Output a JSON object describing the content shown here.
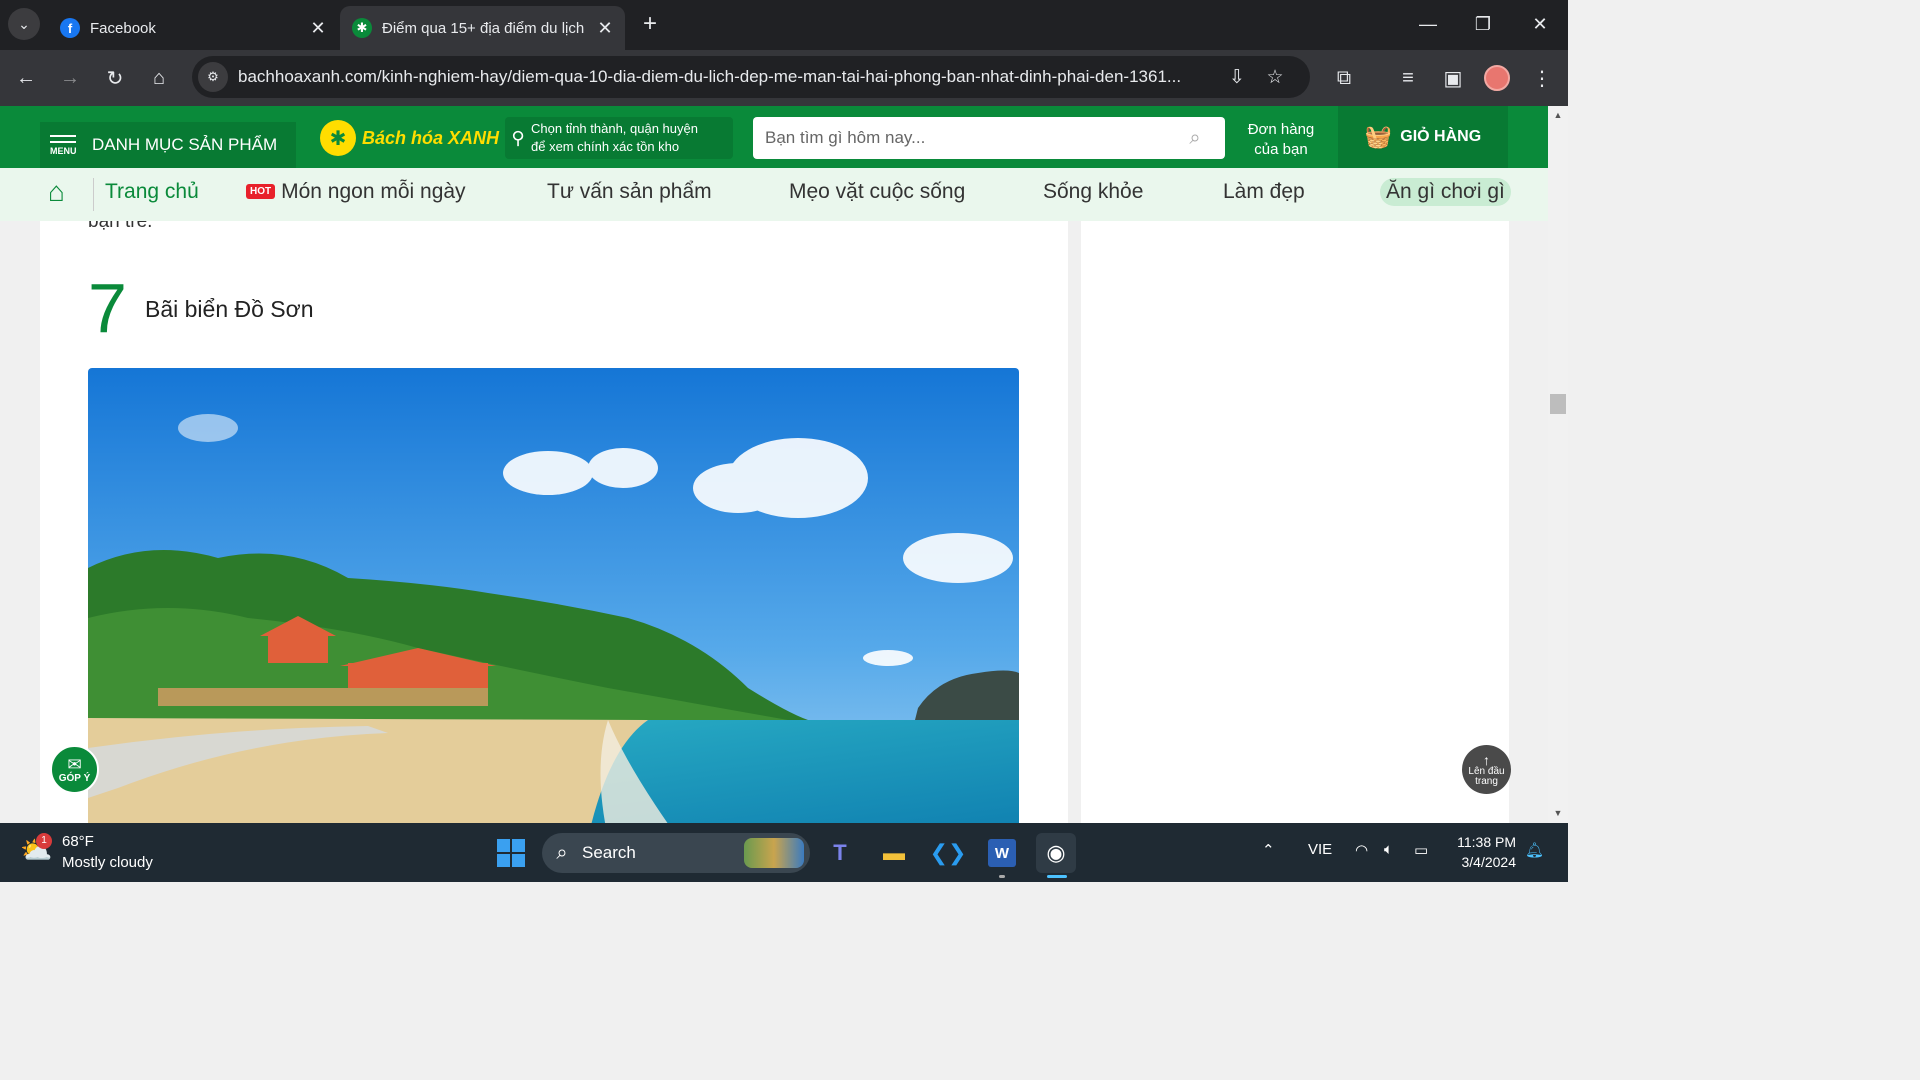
{
  "browser": {
    "tabs": [
      {
        "title": "Facebook",
        "favicon": "facebook-icon",
        "active": false
      },
      {
        "title": "Điểm qua 15+ địa điểm du lịch",
        "favicon": "bachhoaxanh-icon",
        "active": true
      }
    ],
    "url": "bachhoaxanh.com/kinh-nghiem-hay/diem-qua-10-dia-diem-du-lich-dep-me-man-tai-hai-phong-ban-nhat-dinh-phai-den-1361..."
  },
  "site": {
    "menu_label": "DANH MỤC SẢN PHẨM",
    "menu_small": "MENU",
    "logo_text": "Bách hóa XANH",
    "location_line1": "Chọn tỉnh thành, quận huyện",
    "location_line2": "để xem chính xác tồn kho",
    "search_placeholder": "Bạn tìm gì hôm nay...",
    "orders_line1": "Đơn hàng",
    "orders_line2": "của bạn",
    "cart_label": "GIỎ HÀNG",
    "brand_color": "#0a8a3a"
  },
  "nav": {
    "home": "Trang chủ",
    "hot_badge": "HOT",
    "items": [
      "Món ngon mỗi ngày",
      "Tư vấn sản phẩm",
      "Mẹo vặt cuộc sống",
      "Sống khỏe",
      "Làm đẹp",
      "Ăn gì chơi gì"
    ]
  },
  "article": {
    "prev_text": "bạn trẻ.",
    "section_number": "7",
    "section_title": "Bãi biển Đồ Sơn"
  },
  "floating": {
    "feedback": "GÓP Ý",
    "to_top_line1": "Lên đầu",
    "to_top_line2": "trang"
  },
  "taskbar": {
    "weather_temp": "68°F",
    "weather_desc": "Mostly cloudy",
    "weather_badge": "1",
    "search_label": "Search",
    "language": "VIE",
    "time": "11:38 PM",
    "date": "3/4/2024"
  }
}
